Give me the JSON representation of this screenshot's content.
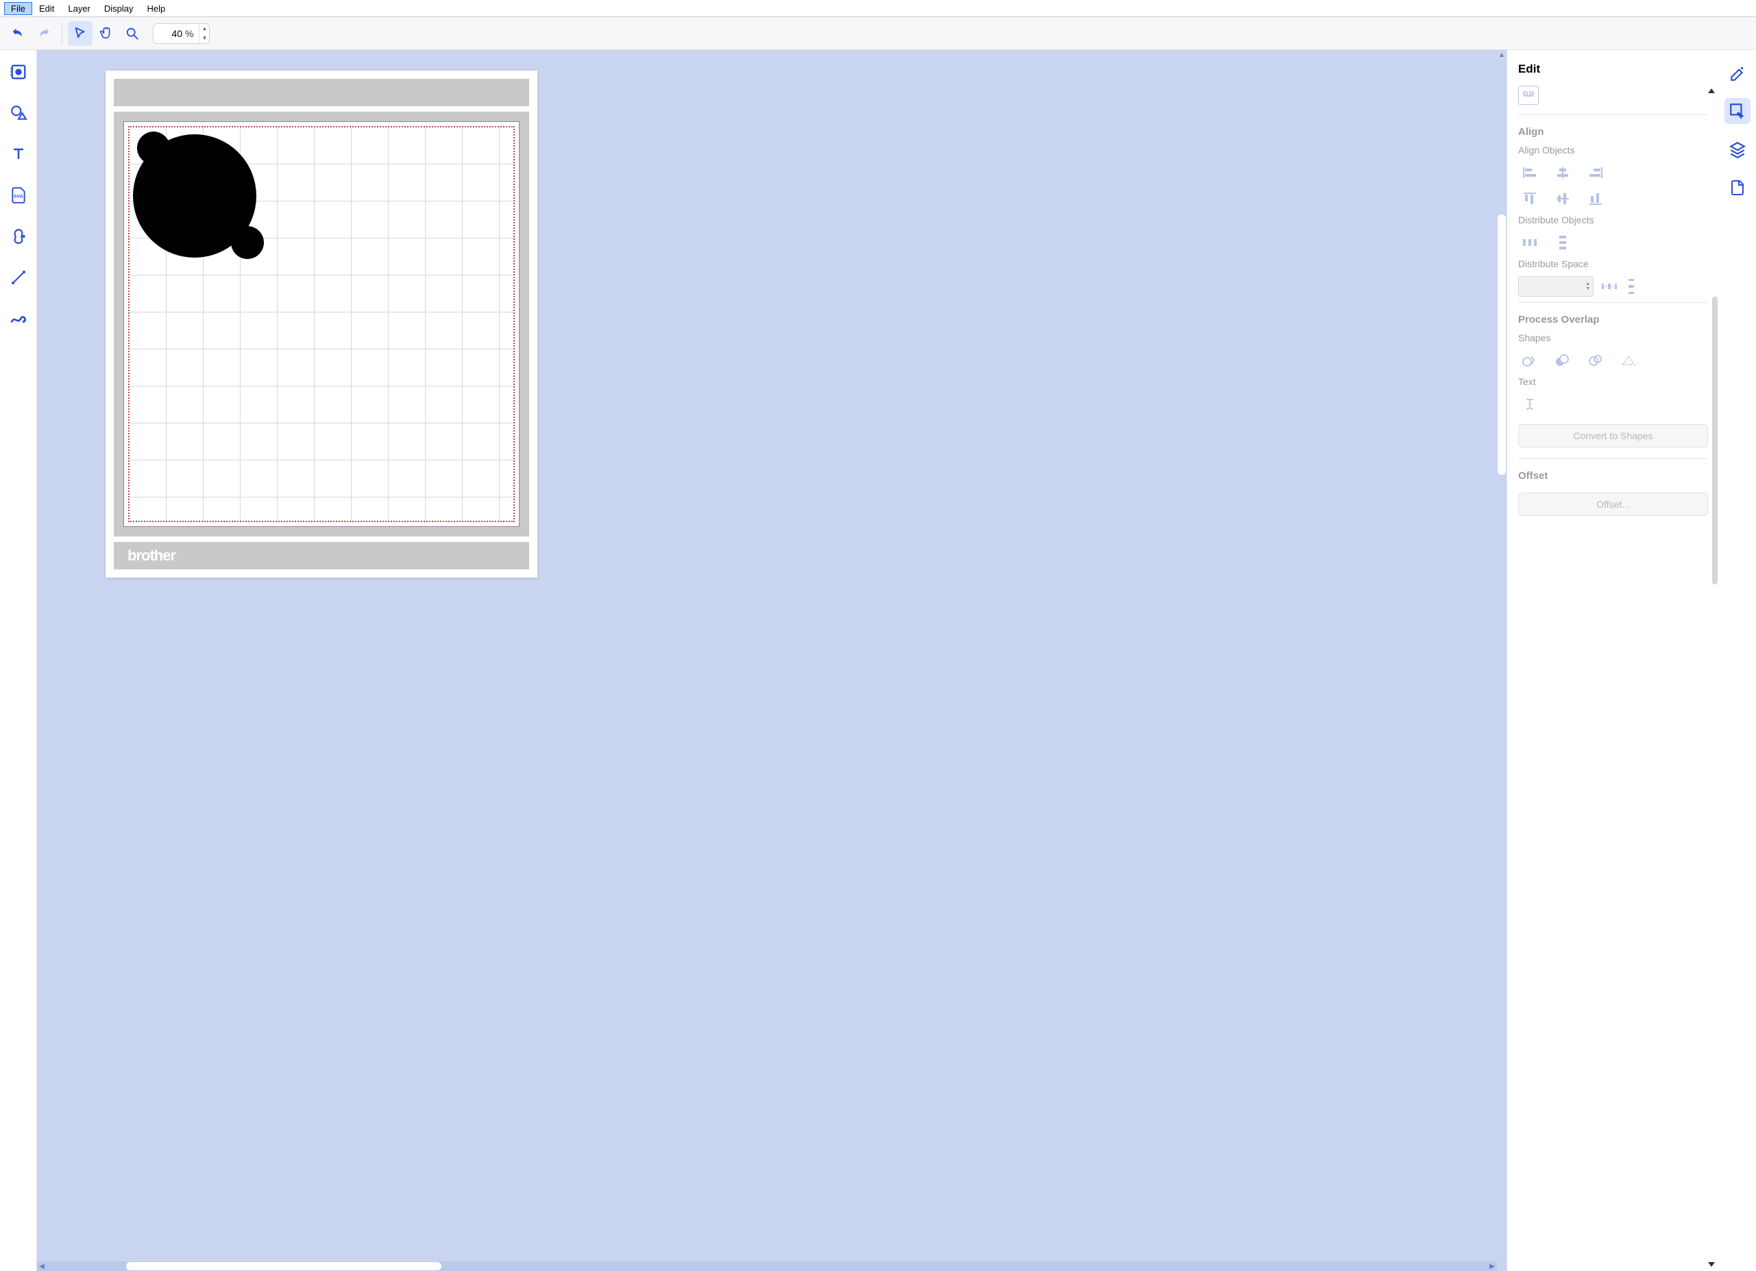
{
  "menubar": {
    "items": [
      "File",
      "Edit",
      "Layer",
      "Display",
      "Help"
    ],
    "selected": 0
  },
  "toolbar": {
    "zoom_value": "40",
    "zoom_unit": "%"
  },
  "right_panel": {
    "title": "Edit",
    "sections": {
      "align": {
        "title": "Align",
        "align_objects_label": "Align Objects",
        "distribute_objects_label": "Distribute Objects",
        "distribute_space_label": "Distribute Space"
      },
      "process_overlap": {
        "title": "Process Overlap",
        "shapes_label": "Shapes",
        "text_label": "Text",
        "convert_button": "Convert to Shapes"
      },
      "offset": {
        "title": "Offset",
        "button": "Offset..."
      }
    }
  },
  "mat": {
    "brand": "brother"
  }
}
